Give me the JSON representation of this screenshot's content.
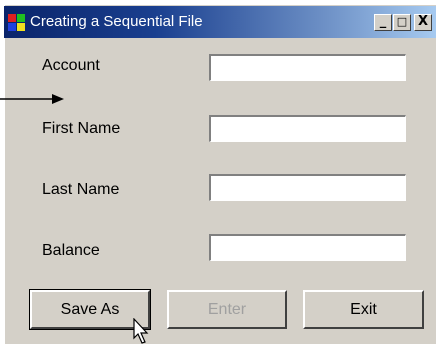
{
  "window": {
    "title": "Creating a Sequential File",
    "icon": "app-window-icon",
    "controls": {
      "minimize": "_",
      "maximize": "□",
      "close": "X"
    }
  },
  "form": {
    "fields": [
      {
        "label": "Account",
        "value": ""
      },
      {
        "label": "First Name",
        "value": ""
      },
      {
        "label": "Last Name",
        "value": ""
      },
      {
        "label": "Balance",
        "value": ""
      }
    ]
  },
  "buttons": {
    "save_as": "Save As",
    "enter": "Enter",
    "exit": "Exit"
  },
  "colors": {
    "window_bg": "#d4d0c8",
    "titlebar_start": "#0a246a",
    "titlebar_end": "#a6caf0",
    "disabled_text": "#a0a0a0"
  }
}
